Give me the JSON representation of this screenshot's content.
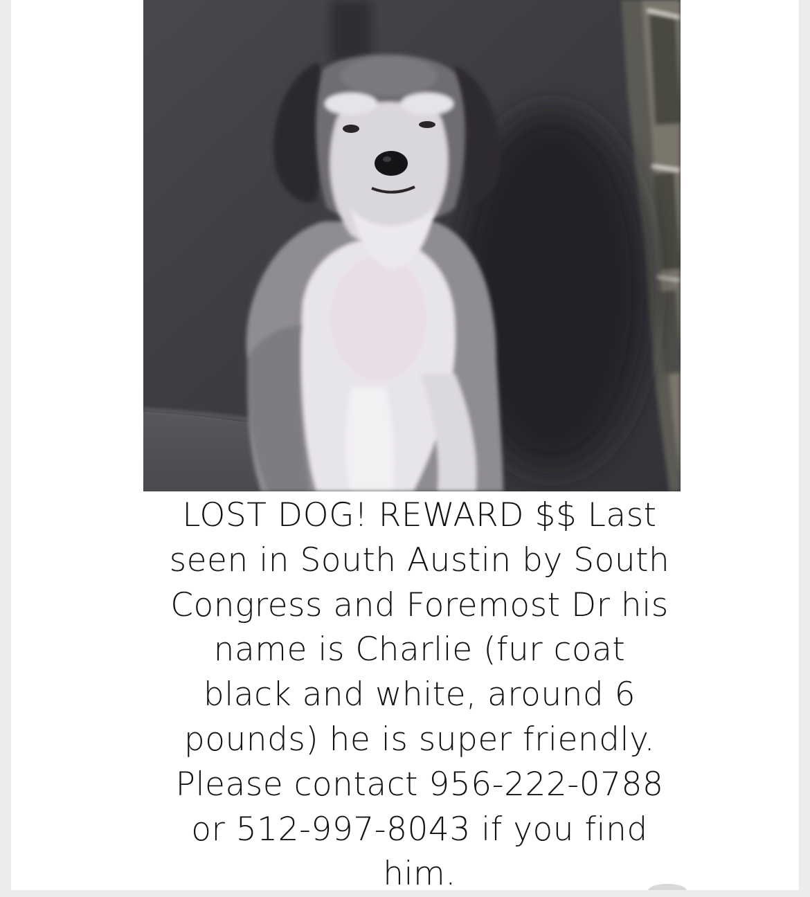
{
  "post": {
    "photo_alt": "Charlie",
    "description_lines": [
      "LOST DOG! REWARD $$ Last",
      "seen in South Austin by South",
      "Congress and Foremost Dr his",
      "name is Charlie (fur coat",
      "black and white, around 6",
      "pounds) he is super friendly.",
      "Please contact 956-222-0788",
      "or 512-997-8043 if you find",
      "him."
    ]
  },
  "colors": {
    "background": "#ececec",
    "card": "#ffffff",
    "text": "#121212",
    "photo_couch": "#3f3e43"
  }
}
